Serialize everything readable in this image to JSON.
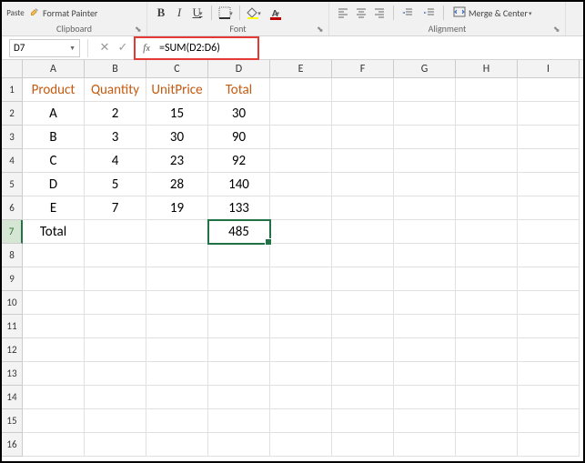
{
  "ribbon": {
    "clipboard": {
      "paste": "Paste",
      "format_painter": "Format Painter",
      "label": "Clipboard"
    },
    "font": {
      "label": "Font"
    },
    "alignment": {
      "merge": "Merge & Center",
      "label": "Alignment"
    }
  },
  "formula_bar": {
    "name_box": "D7",
    "formula": "=SUM(D2:D6)"
  },
  "columns": [
    "A",
    "B",
    "C",
    "D",
    "E",
    "F",
    "G",
    "H",
    "I"
  ],
  "row_numbers": [
    "1",
    "2",
    "3",
    "4",
    "5",
    "6",
    "7",
    "8",
    "9",
    "10",
    "11",
    "12",
    "13",
    "14",
    "15",
    "16"
  ],
  "headers": {
    "A": "Product",
    "B": "Quantity",
    "C": "UnitPrice",
    "D": "Total"
  },
  "data": [
    {
      "A": "A",
      "B": "2",
      "C": "15",
      "D": "30"
    },
    {
      "A": "B",
      "B": "3",
      "C": "30",
      "D": "90"
    },
    {
      "A": "C",
      "B": "4",
      "C": "23",
      "D": "92"
    },
    {
      "A": "D",
      "B": "5",
      "C": "28",
      "D": "140"
    },
    {
      "A": "E",
      "B": "7",
      "C": "19",
      "D": "133"
    }
  ],
  "totals": {
    "A": "Total",
    "D": "485"
  },
  "selected_cell": "D7"
}
